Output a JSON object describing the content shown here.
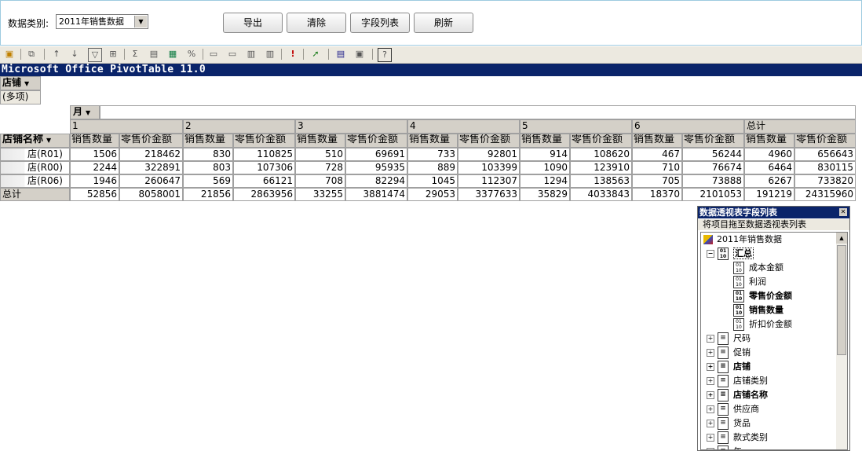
{
  "header": {
    "category_label": "数据类别:",
    "category_value": "2011年销售数据",
    "buttons": [
      "导出",
      "清除",
      "字段列表",
      "刷新"
    ]
  },
  "pivot": {
    "title": "Microsoft Office PivotTable 11.0",
    "filter_field": "店铺",
    "filter_value": "(多项)",
    "column_field": "月",
    "row_field": "店铺名称",
    "months": [
      "1",
      "2",
      "3",
      "4",
      "5",
      "6",
      "总计"
    ],
    "measures": [
      "销售数量",
      "零售价金额"
    ],
    "rows": [
      {
        "name": "店(R01)",
        "values": [
          "1506",
          "218462",
          "830",
          "110825",
          "510",
          "69691",
          "733",
          "92801",
          "914",
          "108620",
          "467",
          "56244",
          "4960",
          "656643"
        ]
      },
      {
        "name": "店(R00)",
        "values": [
          "2244",
          "322891",
          "803",
          "107306",
          "728",
          "95935",
          "889",
          "103399",
          "1090",
          "123910",
          "710",
          "76674",
          "6464",
          "830115"
        ]
      },
      {
        "name": "店(R06)",
        "values": [
          "1946",
          "260647",
          "569",
          "66121",
          "708",
          "82294",
          "1045",
          "112307",
          "1294",
          "138563",
          "705",
          "73888",
          "6267",
          "733820"
        ]
      }
    ],
    "total": {
      "name": "总计",
      "values": [
        "52856",
        "8058001",
        "21856",
        "2863956",
        "33255",
        "3881474",
        "29053",
        "3377633",
        "35829",
        "4033843",
        "18370",
        "2101053",
        "191219",
        "24315960"
      ]
    }
  },
  "field_list": {
    "title": "数据透视表字段列表",
    "subtitle": "将项目拖至数据透视表列表",
    "root": "2011年销售数据",
    "totals_group": "汇总",
    "measures": [
      {
        "label": "成本金额",
        "bold": false
      },
      {
        "label": "利润",
        "bold": false
      },
      {
        "label": "零售价金额",
        "bold": true
      },
      {
        "label": "销售数量",
        "bold": true
      },
      {
        "label": "折扣价金额",
        "bold": false
      }
    ],
    "dimensions": [
      {
        "label": "尺码",
        "bold": false
      },
      {
        "label": "促销",
        "bold": false
      },
      {
        "label": "店铺",
        "bold": true
      },
      {
        "label": "店铺类别",
        "bold": false
      },
      {
        "label": "店铺名称",
        "bold": true
      },
      {
        "label": "供应商",
        "bold": false
      },
      {
        "label": "货品",
        "bold": false
      },
      {
        "label": "款式类别",
        "bold": false
      },
      {
        "label": "年",
        "bold": false
      }
    ]
  }
}
